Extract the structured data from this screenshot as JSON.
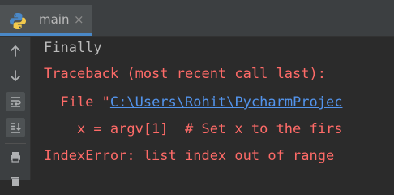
{
  "tab": {
    "label": "main",
    "close_glyph": "×",
    "icon": "python-icon"
  },
  "toolbar": {
    "buttons": [
      "up-arrow-icon",
      "down-arrow-icon",
      "soft-wrap-icon",
      "scroll-to-end-icon",
      "print-icon",
      "delete-icon"
    ]
  },
  "console": {
    "line1": "Finally",
    "line2": "Traceback (most recent call last):",
    "line3_prefix": "  File \"",
    "line3_link": "C:\\Users\\Rohit\\PycharmProjec",
    "line4": "    x = argv[1]  # Set x to the firs",
    "line5": "IndexError: list index out of range"
  },
  "colors": {
    "background": "#2b2b2b",
    "panel": "#3c3f41",
    "text": "#bbbbbb",
    "error": "#ff6b68",
    "link": "#5394ec",
    "accent": "#4a88c7"
  }
}
